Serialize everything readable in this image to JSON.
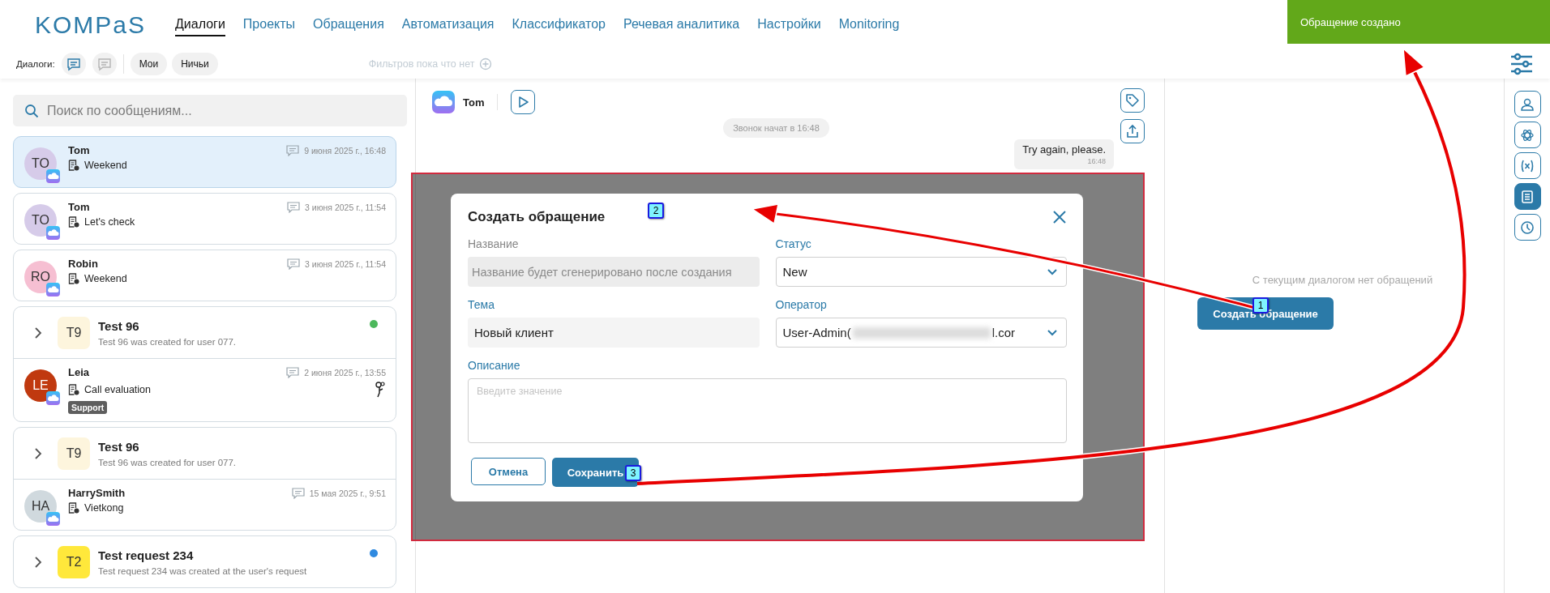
{
  "logo": "KOMPaS",
  "nav": [
    {
      "label": "Диалоги",
      "selected": true
    },
    {
      "label": "Проекты",
      "selected": false
    },
    {
      "label": "Обращения",
      "selected": false
    },
    {
      "label": "Автоматизация",
      "selected": false
    },
    {
      "label": "Классификатор",
      "selected": false
    },
    {
      "label": "Речевая аналитика",
      "selected": false
    },
    {
      "label": "Настройки",
      "selected": false
    },
    {
      "label": "Monitoring",
      "selected": false
    }
  ],
  "toast": {
    "text": "Обращение создано"
  },
  "filters": {
    "label": "Диалоги:",
    "view_buttons": [
      {
        "selected": true
      },
      {
        "selected": false
      }
    ],
    "chips": [
      "Мои",
      "Ничьи"
    ],
    "empty_text": "Фильтров пока что нет"
  },
  "search": {
    "placeholder": "Поиск по сообщениям..."
  },
  "list": [
    {
      "kind": "dialog",
      "initials": "TO",
      "color": "#d6cbe9",
      "name": "Tom",
      "topic": "Weekend",
      "date": "9 июня 2025 г., 16:48",
      "selected": true,
      "scored": false
    },
    {
      "kind": "dialog",
      "initials": "TO",
      "color": "#d6cbe9",
      "name": "Tom",
      "topic": "Let's check",
      "date": "3 июня 2025 г., 11:54",
      "selected": false,
      "scored": false
    },
    {
      "kind": "dialog",
      "initials": "RO",
      "color": "#f6bfd2",
      "name": "Robin",
      "topic": "Weekend",
      "date": "3 июня 2025 г., 11:54",
      "selected": false,
      "scored": false
    },
    {
      "kind": "group",
      "initials": "T9",
      "color": "#fdf5dd",
      "title": "Test 96",
      "subtitle": "Test 96 was created for user 077.",
      "status": {
        "color": "#4cb85c"
      },
      "children": [
        {
          "kind": "dialog",
          "initials": "LE",
          "color": "#c0390f",
          "name": "Leia",
          "topic": "Call evaluation",
          "date": "2 июня 2025 г., 13:55",
          "tag": "Support",
          "selected": false,
          "scored": true
        }
      ]
    },
    {
      "kind": "group",
      "initials": "T9",
      "color": "#fdf5dd",
      "title": "Test 96",
      "subtitle": "Test 96 was created for user 077.",
      "children": [
        {
          "kind": "dialog",
          "initials": "HA",
          "color": "#d0d9de",
          "name": "HarrySmith",
          "topic": "Vietkong",
          "date": "15 мая 2025 г., 9:51",
          "selected": false,
          "scored": false
        }
      ]
    },
    {
      "kind": "group",
      "initials": "T2",
      "color": "#ffe83b",
      "title": "Test request 234",
      "subtitle": "Test request 234 was created at the user's request",
      "status": {
        "color": "#2f8ae0"
      }
    }
  ],
  "chat": {
    "contact": "Tom",
    "system_note": "Звонок начат в 16:48",
    "messages": [
      {
        "text": "Try again, please.",
        "time": "16:48"
      }
    ]
  },
  "panel": {
    "empty_text": "С текущим диалогом нет обращений",
    "create_button": "Создать обращение"
  },
  "sidebar": [
    {
      "selected": false
    },
    {
      "selected": false
    },
    {
      "selected": false
    },
    {
      "selected": true
    },
    {
      "selected": false
    }
  ],
  "modal": {
    "title": "Создать обращение",
    "fields": [
      {
        "kind": "text",
        "label": "Название",
        "value": "Название будет сгенерировано после создания",
        "disabled": true
      },
      {
        "kind": "select",
        "label": "Статус",
        "value": "New",
        "disabled": false
      },
      {
        "kind": "text",
        "label": "Тема",
        "value": "Новый клиент",
        "disabled": false
      },
      {
        "kind": "select",
        "label": "Оператор",
        "value": "User-Admin(",
        "value_tail": "l.cor",
        "disabled": false
      },
      {
        "kind": "textarea",
        "label": "Описание",
        "placeholder": "Введите значение",
        "disabled": false
      }
    ],
    "buttons": [
      {
        "kind": "secondary",
        "label": "Отмена"
      },
      {
        "kind": "primary",
        "label": "Сохранить"
      }
    ]
  },
  "annotations": [
    {
      "number": "1"
    },
    {
      "number": "2"
    },
    {
      "number": "3"
    }
  ]
}
